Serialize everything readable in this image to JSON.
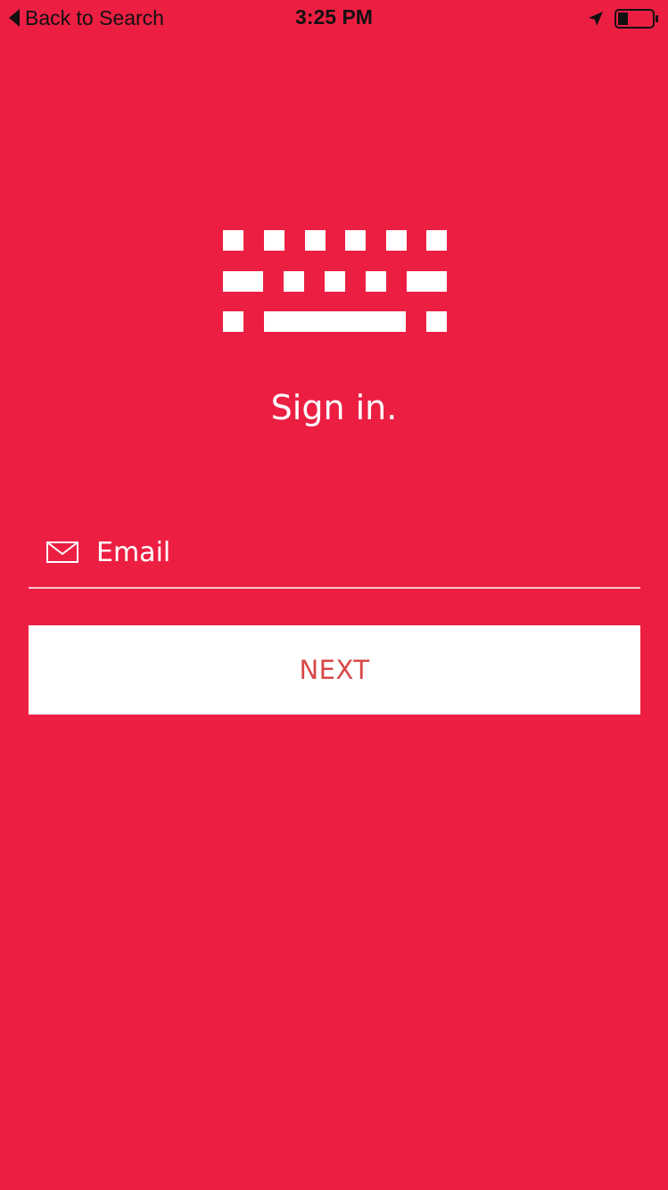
{
  "status_bar": {
    "back_label": "Back to Search",
    "time": "3:25 PM",
    "battery_level": 0.3
  },
  "header": {
    "logo_icon": "keyboard-icon",
    "title": "Sign in."
  },
  "form": {
    "email_icon": "mail-icon",
    "email_placeholder": "Email",
    "email_value": "",
    "next_label": "NEXT"
  },
  "colors": {
    "background": "#ec1f43",
    "button_background": "#ffffff",
    "button_text": "#d84848",
    "foreground": "#ffffff"
  }
}
